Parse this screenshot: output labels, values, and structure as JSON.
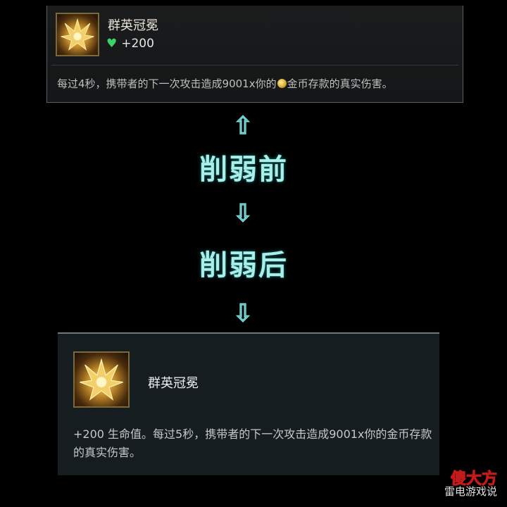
{
  "top_card": {
    "item_name": "群英冠冕",
    "stat_value": "+200",
    "description_before_coin": "每过4秒，携带者的下一次攻击造成9001x你的",
    "description_after_coin": "金币存款的真实伤害。"
  },
  "comparison": {
    "up_arrow": "⇧",
    "before_label": "削弱前",
    "down_arrow_1": "⇩",
    "after_label": "削弱后",
    "down_arrow_2": "⇩"
  },
  "bottom_card": {
    "item_name": "群英冠冕",
    "description": "+200 生命值。每过5秒，携带者的下一次攻击造成9001x你的金币存款的真实伤害。"
  },
  "watermark": {
    "text": "雷电游戏说",
    "brand": "傻大方"
  },
  "colors": {
    "accent_cyan": "#a8efe9",
    "heart_green": "#3bd46a"
  },
  "icons": {
    "item_icon": "crown-icon",
    "stat_icon": "heart-icon",
    "coin_icon": "gold-coin-icon"
  }
}
